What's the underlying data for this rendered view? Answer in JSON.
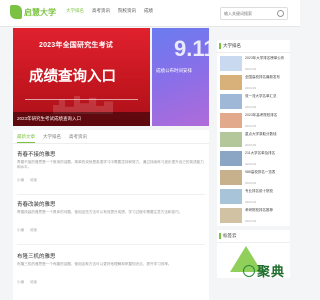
{
  "site": {
    "logo_text": "启慧大学"
  },
  "nav": {
    "items": [
      "大学排名",
      "高考资讯",
      "院校资讯",
      "成绩"
    ],
    "active_index": 0
  },
  "search": {
    "placeholder": "输入关键词搜索"
  },
  "banner": {
    "title": "2023年全国研究生考试",
    "big_text": "成绩查询入口",
    "caption": "2023年研究生考试成绩查询入口",
    "side_number": "9.11",
    "side_text": "成绩公布时间安排"
  },
  "tabs": [
    "最新文章",
    "大学排名",
    "高考资讯"
  ],
  "articles": [
    {
      "title": "青春不接的雅思",
      "desc": "青春不接的雅思是一个常用的话题，简单的说就是英语学习中需要坚持和努力，通过持续练习逐步提升自己的英语能力和水平。",
      "author": "小编",
      "views": "阅读"
    },
    {
      "title": "青春改装的雅思",
      "desc": "青春改装的雅思是一个具体的问题，使用这些方法可以有效提升成绩，学习过程中需要注意方法和技巧。",
      "author": "小编",
      "views": "阅读"
    },
    {
      "title": "布隆三机的雅思",
      "desc": "布隆三机的雅思是一个有趣的话题，使用这种方法可以更好地理解和掌握知识点，提升学习效率。",
      "author": "小编",
      "views": "阅读"
    }
  ],
  "sidebar": {
    "card1_title": "大学排名",
    "items": [
      {
        "text": "2023年大学排名榜单公布",
        "date": "2023-09"
      },
      {
        "text": "全国高校排名最新发布",
        "date": "2023-09"
      },
      {
        "text": "双一流大学名单汇总",
        "date": "2023-09"
      },
      {
        "text": "2023年高考院校排名",
        "date": "2023-09"
      },
      {
        "text": "重点大学录取分数线",
        "date": "2023-09"
      },
      {
        "text": "211大学名单及排名",
        "date": "2023-09"
      },
      {
        "text": "985高校排名一览表",
        "date": "2023-09"
      },
      {
        "text": "专业排名前十院校",
        "date": "2023-09"
      },
      {
        "text": "考研院校排名推荐",
        "date": "2023-09"
      }
    ],
    "card2_title": "标签云"
  },
  "watermark": {
    "text": "聚典"
  },
  "colors": {
    "accent": "#7cc242",
    "banner_red": "#d21a24"
  }
}
